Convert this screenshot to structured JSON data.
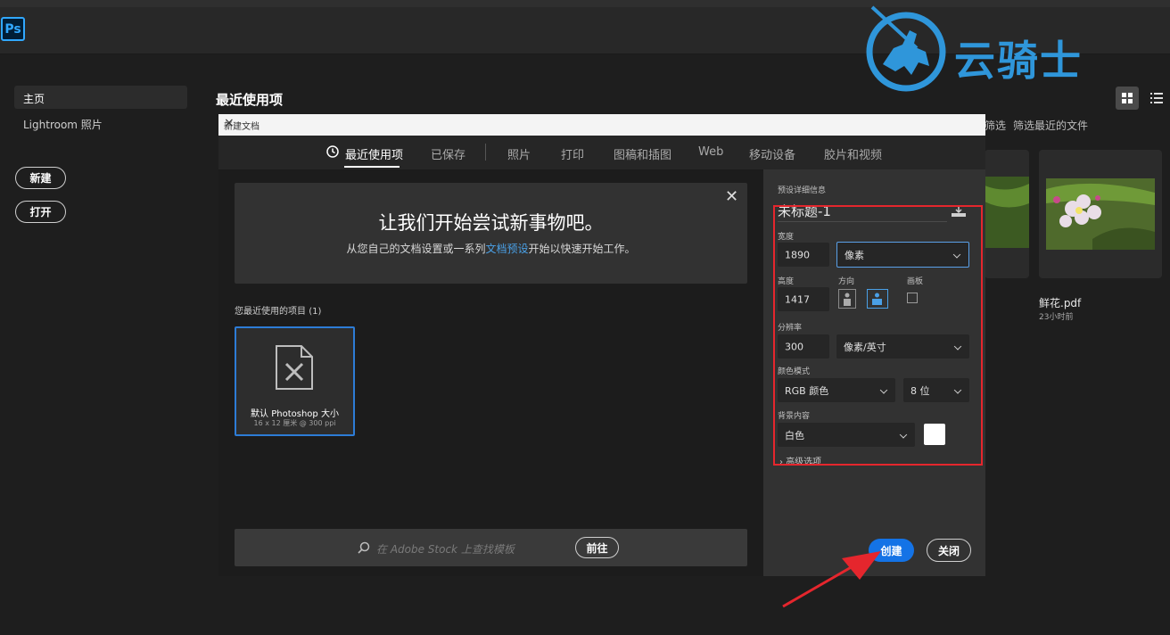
{
  "app": {
    "logo_text": "Ps",
    "menu_bar": [
      "",
      "",
      "",
      "",
      "",
      "",
      "",
      "",
      "",
      "",
      ""
    ]
  },
  "watermark": {
    "text": "云骑士"
  },
  "sidebar": {
    "home_label": "主页",
    "lightroom_label": "Lightroom 照片",
    "new_label": "新建",
    "open_label": "打开"
  },
  "home": {
    "recent_title": "最近使用项",
    "filter_a": "筛选",
    "filter_b": "筛选最近的文件",
    "recent_file": {
      "name": "鲜花.pdf",
      "time": "23小时前"
    }
  },
  "dialog": {
    "title": "新建文档",
    "tabs": [
      {
        "label": "最近使用项",
        "active": true
      },
      {
        "label": "已保存",
        "active": false
      },
      {
        "label": "照片",
        "active": false
      },
      {
        "label": "打印",
        "active": false
      },
      {
        "label": "图稿和插图",
        "active": false
      },
      {
        "label": "Web",
        "active": false
      },
      {
        "label": "移动设备",
        "active": false
      },
      {
        "label": "胶片和视频",
        "active": false
      }
    ],
    "banner": {
      "heading": "让我们开始尝试新事物吧。",
      "sub_before": "从您自己的文档设置或一系列",
      "sub_link": "文档预设",
      "sub_after": "开始以快速开始工作。"
    },
    "recent_items_label": "您最近使用的项目",
    "recent_items_count": "(1)",
    "preset_card": {
      "name": "默认 Photoshop 大小",
      "detail": "16 x 12 厘米 @ 300 ppi"
    },
    "stock": {
      "placeholder": "在 Adobe Stock 上查找模板",
      "go_label": "前往"
    },
    "details": {
      "section_label": "预设详细信息",
      "name_value": "未标题-1",
      "width_label": "宽度",
      "width_value": "1890",
      "width_unit": "像素",
      "height_label": "高度",
      "height_value": "1417",
      "orientation_label": "方向",
      "artboard_label": "画板",
      "resolution_label": "分辨率",
      "resolution_value": "300",
      "resolution_unit": "像素/英寸",
      "color_mode_label": "颜色模式",
      "color_mode_value": "RGB 颜色",
      "bit_depth_value": "8 位",
      "background_label": "背景内容",
      "background_value": "白色",
      "advanced_label": "高级选项"
    },
    "create_label": "创建",
    "close_label": "关闭"
  },
  "colors": {
    "accent": "#1473e6",
    "highlight_box": "#e5262d",
    "watermark": "#2f96da",
    "link": "#4aa0e6"
  }
}
